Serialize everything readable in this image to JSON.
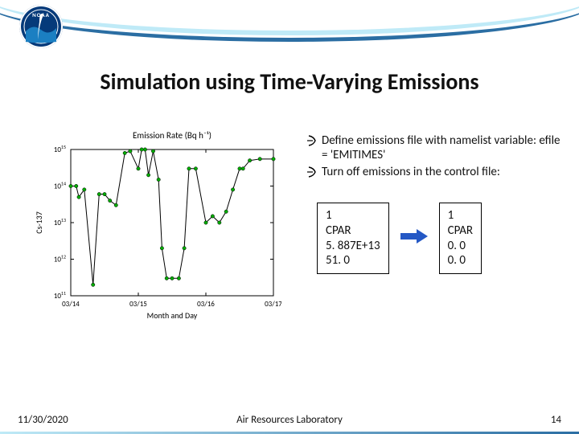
{
  "logo": {
    "acronym": "NOAA"
  },
  "title": "Simulation using Time-Varying Emissions",
  "bullets": [
    "Define emissions file with namelist variable:  efile = 'EMITIMES'",
    "Turn off emissions in the control file:"
  ],
  "boxes": {
    "left": "1\nCPAR\n5. 887E+13\n51. 0",
    "right": "1\nCPAR\n0. 0\n0. 0"
  },
  "footer": {
    "date": "11/30/2020",
    "center": "Air Resources Laboratory",
    "page": "14"
  },
  "chart_data": {
    "type": "line",
    "title": "Emission Rate (Bq h⁻¹)",
    "ylabel": "Cs-137",
    "xlabel": "Month and Day",
    "x_ticks": [
      "03/14",
      "03/15",
      "03/16",
      "03/17"
    ],
    "y_scale": "log",
    "ylim": [
      100000000000.0,
      1000000000000000.0
    ],
    "y_ticks": [
      100000000000.0,
      1000000000000.0,
      10000000000000.0,
      100000000000000.0,
      1000000000000000.0
    ],
    "points": [
      {
        "t": 0.0,
        "y": 100000000000000.0
      },
      {
        "t": 0.08,
        "y": 100000000000000.0
      },
      {
        "t": 0.12,
        "y": 50000000000000.0
      },
      {
        "t": 0.2,
        "y": 80000000000000.0
      },
      {
        "t": 0.33,
        "y": 200000000000.0
      },
      {
        "t": 0.42,
        "y": 60000000000000.0
      },
      {
        "t": 0.5,
        "y": 60000000000000.0
      },
      {
        "t": 0.58,
        "y": 40000000000000.0
      },
      {
        "t": 0.67,
        "y": 30000000000000.0
      },
      {
        "t": 0.8,
        "y": 800000000000000.0
      },
      {
        "t": 0.88,
        "y": 900000000000000.0
      },
      {
        "t": 1.0,
        "y": 300000000000000.0
      },
      {
        "t": 1.05,
        "y": 1000000000000000.0
      },
      {
        "t": 1.1,
        "y": 1000000000000000.0
      },
      {
        "t": 1.15,
        "y": 200000000000000.0
      },
      {
        "t": 1.22,
        "y": 900000000000000.0
      },
      {
        "t": 1.3,
        "y": 150000000000000.0
      },
      {
        "t": 1.35,
        "y": 2000000000000.0
      },
      {
        "t": 1.42,
        "y": 300000000000.0
      },
      {
        "t": 1.5,
        "y": 300000000000.0
      },
      {
        "t": 1.6,
        "y": 300000000000.0
      },
      {
        "t": 1.68,
        "y": 2000000000000.0
      },
      {
        "t": 1.75,
        "y": 300000000000000.0
      },
      {
        "t": 1.85,
        "y": 300000000000000.0
      },
      {
        "t": 2.0,
        "y": 10000000000000.0
      },
      {
        "t": 2.1,
        "y": 15000000000000.0
      },
      {
        "t": 2.2,
        "y": 10000000000000.0
      },
      {
        "t": 2.3,
        "y": 20000000000000.0
      },
      {
        "t": 2.4,
        "y": 80000000000000.0
      },
      {
        "t": 2.5,
        "y": 300000000000000.0
      },
      {
        "t": 2.55,
        "y": 300000000000000.0
      },
      {
        "t": 2.65,
        "y": 500000000000000.0
      },
      {
        "t": 2.8,
        "y": 550000000000000.0
      },
      {
        "t": 3.0,
        "y": 550000000000000.0
      }
    ]
  }
}
